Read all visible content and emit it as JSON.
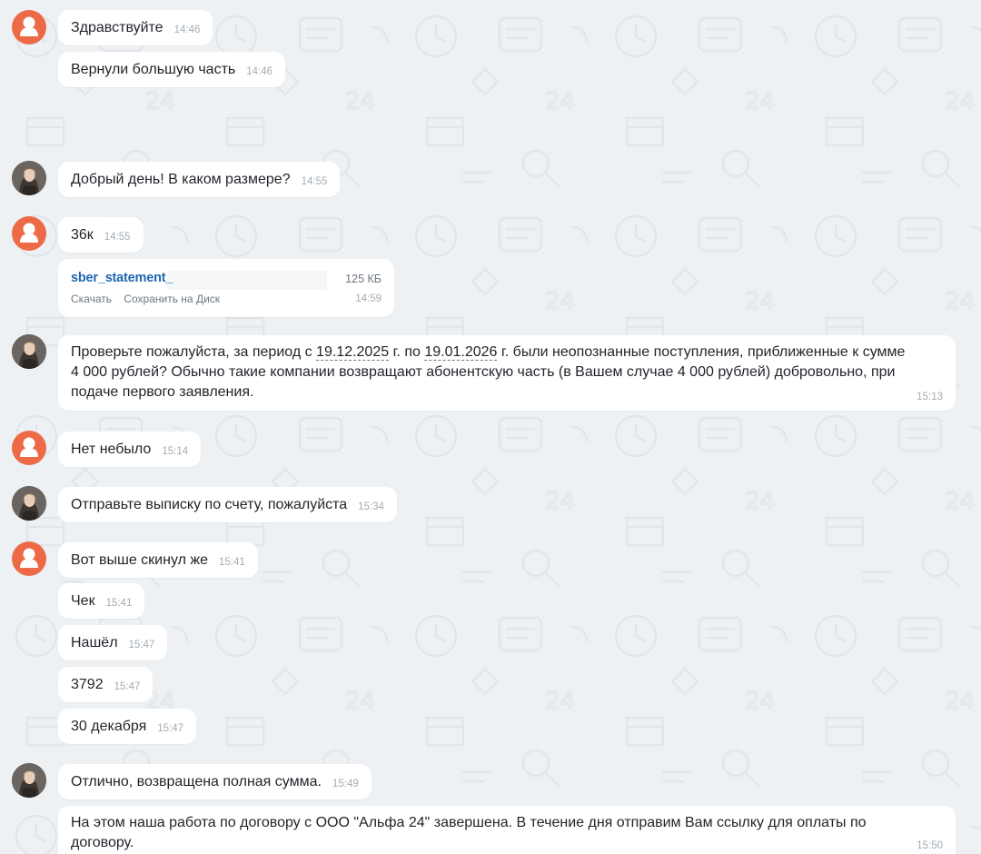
{
  "colors": {
    "background": "#eef1f4",
    "bubble": "#ffffff",
    "default_avatar": "#ec6a45",
    "link": "#2067b0",
    "time": "#a4acb3"
  },
  "messages": {
    "m1": {
      "text": "Здравствуйте",
      "time": "14:46"
    },
    "m2": {
      "text": "Вернули большую часть",
      "time": "14:46"
    },
    "m3": {
      "text": "Добрый день! В каком размере?",
      "time": "14:55"
    },
    "m4": {
      "text": "36к",
      "time": "14:55"
    },
    "file": {
      "name": "sber_statement_",
      "size": "125 КБ",
      "download_label": "Скачать",
      "save_label": "Сохранить на Диск",
      "time": "14:59"
    },
    "m5": {
      "part1": "Проверьте пожалуйста, за период с ",
      "date1": "19.12.2025",
      "part2": " г. по ",
      "date2": "19.01.2026",
      "part3": " г. были неопознанные поступления, приближенные к сумме 4 000 рублей? Обычно такие компании возвращают абонентскую часть (в Вашем случае 4 000 рублей) добровольно, при подаче первого заявления.",
      "time": "15:13"
    },
    "m6": {
      "text": "Нет небыло",
      "time": "15:14"
    },
    "m7": {
      "text": "Отправьте выписку по счету, пожалуйста",
      "time": "15:34"
    },
    "m8": {
      "text": "Вот выше скинул же",
      "time": "15:41"
    },
    "m9": {
      "text": "Чек",
      "time": "15:41"
    },
    "m10": {
      "text": "Нашёл",
      "time": "15:47"
    },
    "m11": {
      "text": "3792",
      "time": "15:47"
    },
    "m12": {
      "text": "30 декабря",
      "time": "15:47"
    },
    "m13": {
      "text": "Отлично, возвращена полная сумма.",
      "time": "15:49"
    },
    "m14": {
      "text": "На этом наша работа по договору с ООО \"Альфа 24\" завершена. В течение дня отправим Вам ссылку для оплаты по договору.",
      "time": "15:50"
    }
  }
}
